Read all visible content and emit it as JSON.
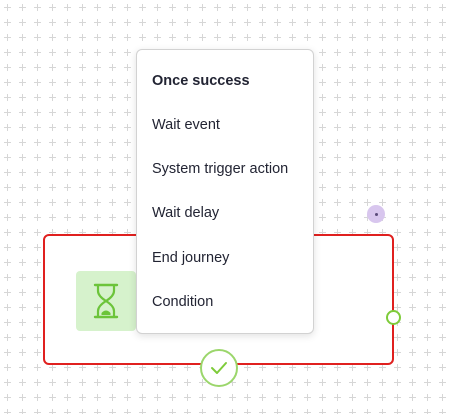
{
  "menu": {
    "header": "Once success",
    "items": [
      {
        "label": "Wait event"
      },
      {
        "label": "System trigger action"
      },
      {
        "label": "Wait delay"
      },
      {
        "label": "End journey"
      },
      {
        "label": "Condition"
      }
    ]
  },
  "node": {
    "icon": "hourglass-icon",
    "status_icon": "checkmark-icon",
    "border_color": "#e0201f",
    "icon_bg": "#d6f2cc",
    "accent": "#7ecb3a"
  },
  "more_button": {
    "icon": "ellipsis-icon",
    "color": "#d8c6ee"
  }
}
